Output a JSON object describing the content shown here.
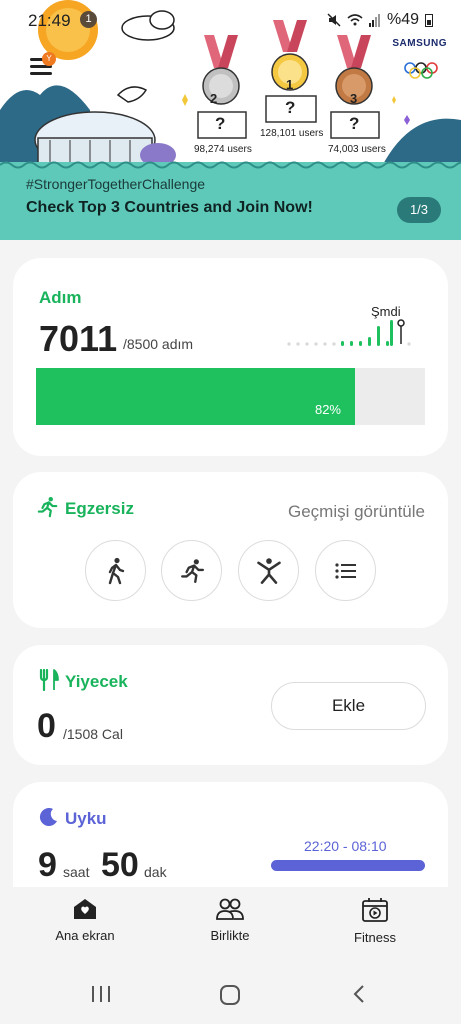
{
  "status_bar": {
    "time": "21:49",
    "notification_count": "1",
    "battery": "%49"
  },
  "banner": {
    "menu_badge": "Y",
    "medals": [
      {
        "rank": "2",
        "users": "98,274 users"
      },
      {
        "rank": "1",
        "users": "128,101 users"
      },
      {
        "rank": "3",
        "users": "74,003 users"
      }
    ],
    "brand": "SAMSUNG",
    "hashtag": "#StrongerTogetherChallenge",
    "title": "Check Top 3 Countries and Join Now!",
    "page_indicator": "1/3"
  },
  "steps": {
    "title": "Adım",
    "value": "7011",
    "goal": "/8500 adım",
    "now_label": "Şmdi",
    "progress_percent": 82,
    "progress_label": "82%"
  },
  "exercise": {
    "title": "Egzersiz",
    "history_link": "Geçmişi görüntüle",
    "buttons": [
      "walking-icon",
      "running-icon",
      "workout-icon",
      "list-icon"
    ]
  },
  "food": {
    "title": "Yiyecek",
    "value": "0",
    "goal": "/1508 Cal",
    "add_label": "Ekle"
  },
  "sleep": {
    "title": "Uyku",
    "hours": "9",
    "hours_unit": "saat",
    "minutes": "50",
    "minutes_unit": "dak",
    "range": "22:20 - 08:10"
  },
  "bottom_nav": {
    "items": [
      {
        "label": "Ana ekran",
        "icon": "home-icon"
      },
      {
        "label": "Birlikte",
        "icon": "people-icon"
      },
      {
        "label": "Fitness",
        "icon": "fitness-icon"
      }
    ]
  },
  "colors": {
    "steps": "#1fc15f",
    "sleep": "#5b63d6",
    "banner_sea": "#5ec9b8"
  }
}
